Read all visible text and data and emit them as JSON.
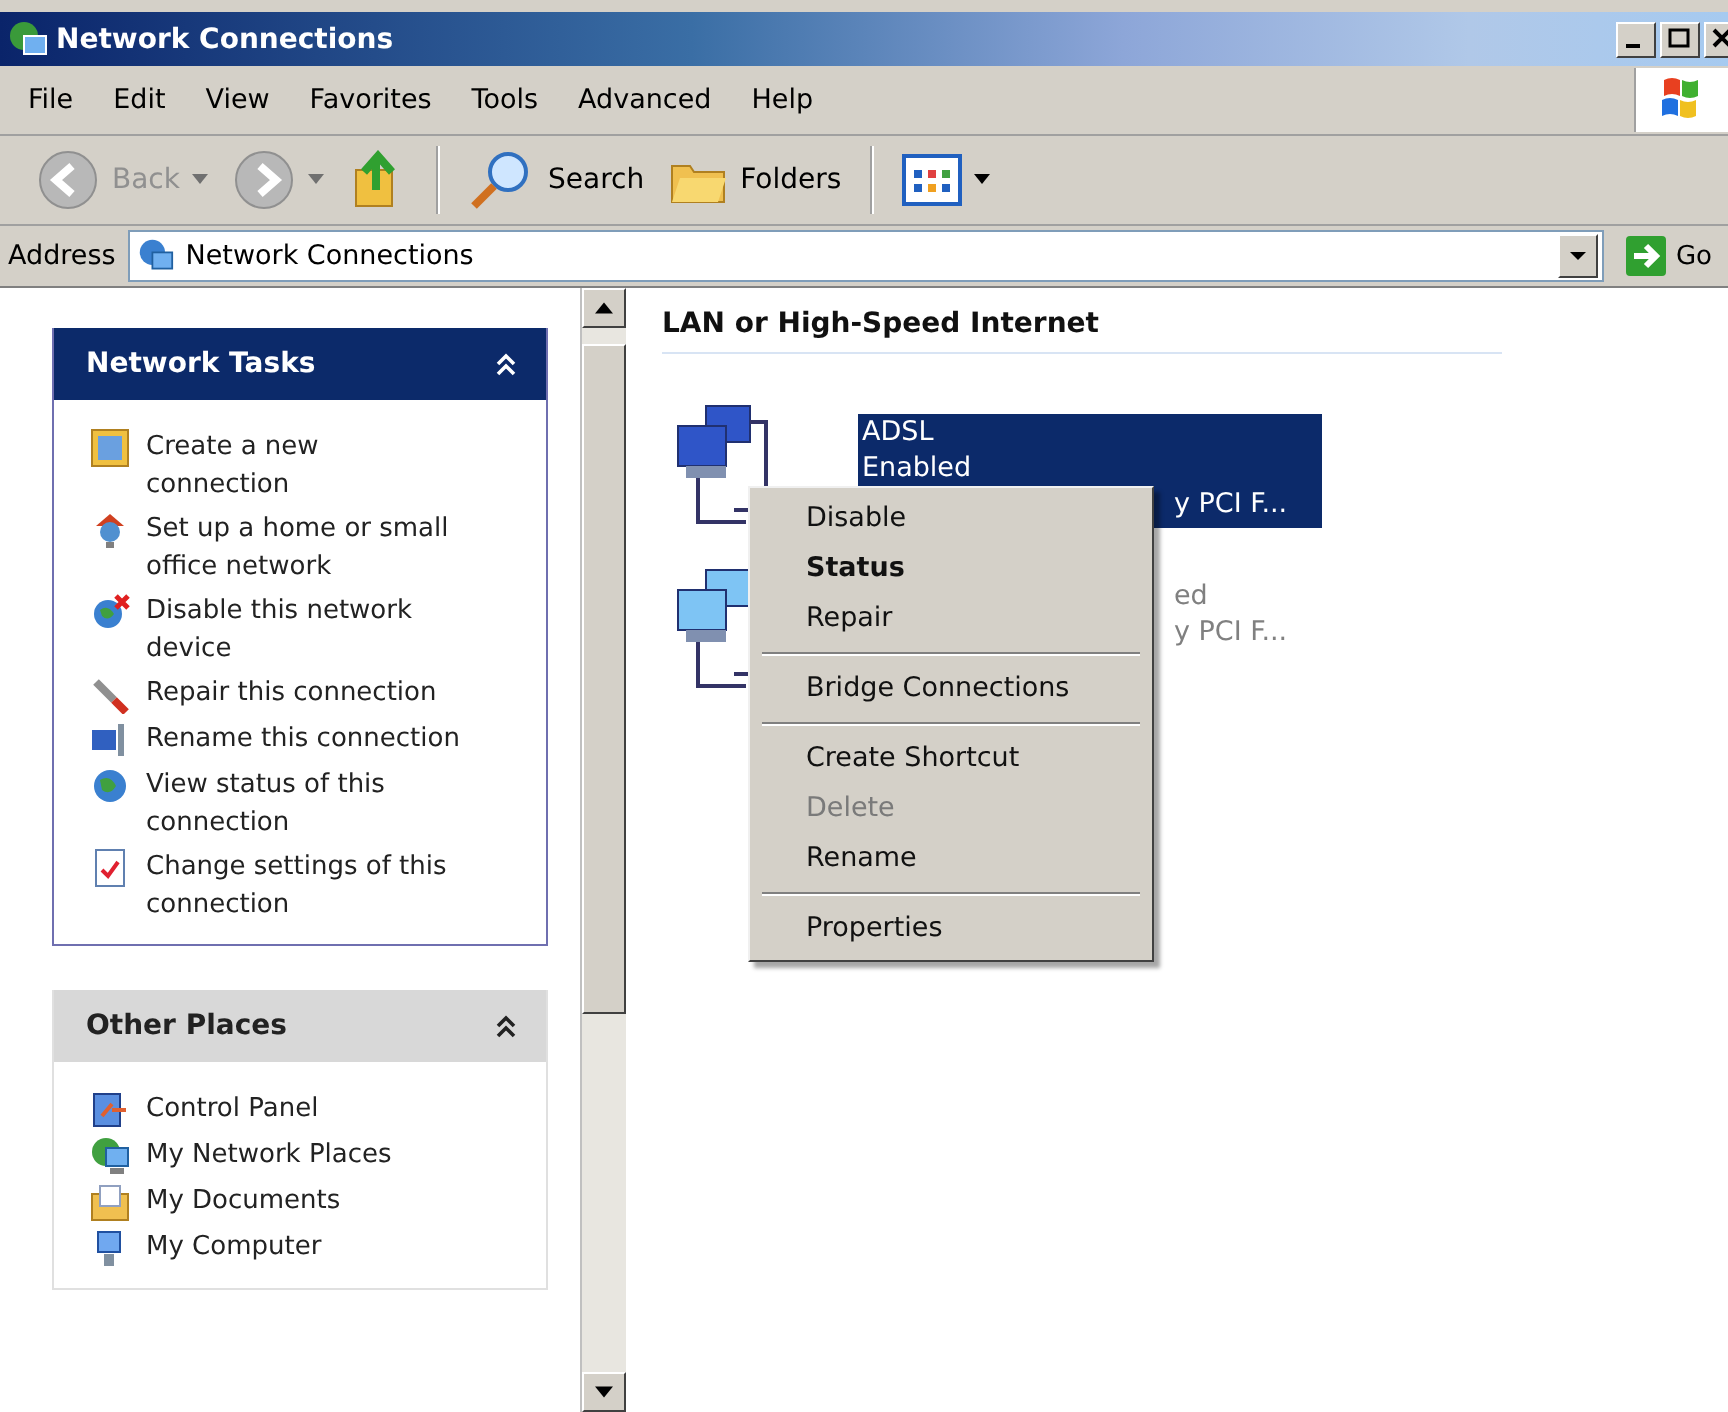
{
  "window": {
    "title": "Network Connections"
  },
  "menu_bar": [
    "File",
    "Edit",
    "View",
    "Favorites",
    "Tools",
    "Advanced",
    "Help"
  ],
  "toolbar": [
    {
      "kind": "back",
      "label": "Back",
      "disabled": true,
      "dropdown": true
    },
    {
      "kind": "forward",
      "disabled": true,
      "dropdown": true
    },
    {
      "kind": "up"
    },
    {
      "kind": "separator"
    },
    {
      "kind": "search",
      "label": "Search"
    },
    {
      "kind": "folders",
      "label": "Folders"
    },
    {
      "kind": "separator"
    },
    {
      "kind": "views",
      "dropdown": true
    }
  ],
  "address": {
    "label": "Address",
    "value": "Network Connections",
    "go": "Go"
  },
  "task_panels": [
    {
      "title": "Network Tasks",
      "kind": "special",
      "expanded": true,
      "items": [
        {
          "kind": "new-connection",
          "label": "Create a new connection"
        },
        {
          "kind": "home-network",
          "label": "Set up a home or small office network"
        },
        {
          "kind": "disable",
          "label": "Disable this network device"
        },
        {
          "kind": "repair",
          "label": "Repair this connection"
        },
        {
          "kind": "rename",
          "label": "Rename this connection"
        },
        {
          "kind": "status",
          "label": "View status of this connection"
        },
        {
          "kind": "settings",
          "label": "Change settings of this connection"
        }
      ]
    },
    {
      "title": "Other Places",
      "kind": "normal",
      "expanded": true,
      "items": [
        {
          "kind": "control-panel",
          "label": "Control Panel"
        },
        {
          "kind": "network-places",
          "label": "My Network Places"
        },
        {
          "kind": "documents",
          "label": "My Documents"
        },
        {
          "kind": "computer",
          "label": "My Computer"
        }
      ]
    }
  ],
  "group": {
    "title": "LAN or High-Speed Internet",
    "connections": [
      {
        "selected": true,
        "lines": [
          {
            "text": "ADSL",
            "kind": "full"
          },
          {
            "text": "Enabled",
            "kind": "full"
          },
          {
            "text": "y PCI F...",
            "kind": "clipped"
          }
        ]
      },
      {
        "selected": false,
        "lines": [
          {
            "text": "ed",
            "kind": "clipped"
          },
          {
            "text": "y PCI F...",
            "kind": "clipped"
          }
        ]
      }
    ]
  },
  "context_menu": [
    {
      "kind": "item",
      "label": "Disable",
      "default": false,
      "disabled": false
    },
    {
      "kind": "item",
      "label": "Status",
      "default": true,
      "disabled": false
    },
    {
      "kind": "item",
      "label": "Repair",
      "default": false,
      "disabled": false
    },
    {
      "kind": "separator"
    },
    {
      "kind": "item",
      "label": "Bridge Connections",
      "default": false,
      "disabled": false
    },
    {
      "kind": "separator"
    },
    {
      "kind": "item",
      "label": "Create Shortcut",
      "default": false,
      "disabled": false
    },
    {
      "kind": "item",
      "label": "Delete",
      "default": false,
      "disabled": true
    },
    {
      "kind": "item",
      "label": "Rename",
      "default": false,
      "disabled": false
    },
    {
      "kind": "separator"
    },
    {
      "kind": "item",
      "label": "Properties",
      "default": false,
      "disabled": false
    }
  ]
}
